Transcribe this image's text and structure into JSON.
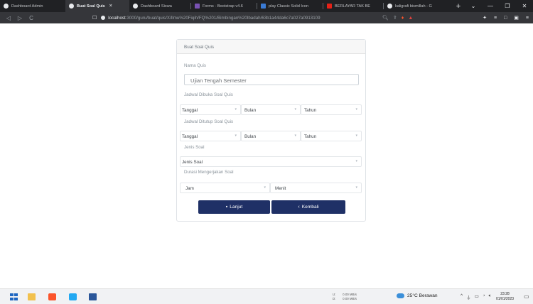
{
  "browser": {
    "tabs": [
      {
        "label": "Dashboard Admin",
        "active": false
      },
      {
        "label": "Buat Soal Quis",
        "active": true
      },
      {
        "label": "Dashboard Siswa",
        "active": false
      },
      {
        "label": "Forms · Bootstrap v4.6",
        "active": false
      },
      {
        "label": "play Classic Solid Icon",
        "active": false
      },
      {
        "label": "BERLAYAR TAK BE",
        "active": false
      },
      {
        "label": "kaligrafi bismillah - G",
        "active": false
      }
    ],
    "tab_close": "×",
    "new_tab": "+",
    "window_controls": {
      "minimize": "—",
      "restore": "❐",
      "close": "✕"
    },
    "nav": {
      "back": "◁",
      "forward": "▷",
      "reload": "C"
    },
    "url_host": "localhost",
    "url_path": ":3000/guru/buat/quis/X/Ilmu%20Fiqih/FQ%201/Bimbingan%20Ibadah/63b1a44da6c7a027a0913109"
  },
  "form": {
    "header": "Buat Soal Quis",
    "nama_label": "Nama Quis",
    "nama_value": "Ujian Tengah Semester",
    "open_label": "Jadwal Dibuka Soal Quis",
    "open_day": "Tanggal",
    "open_month": "Bulan",
    "open_year": "Tahun",
    "close_label": "Jadwal Ditutup Soal Quis",
    "close_day": "Tanggal",
    "close_month": "Bulan",
    "close_year": "Tahun",
    "jenis_label": "Jenis Soal",
    "jenis_value": "Jenis Soal",
    "durasi_label": "Durasi Mengerjakan Soal",
    "durasi_jam": "Jam",
    "durasi_menit": "Menit",
    "lanjut_label": "Lanjut",
    "kembali_label": "Kembali",
    "accent_color": "#1f3066"
  },
  "taskbar": {
    "net_upload": "0.00 MB/s",
    "net_download": "0.00 MB/s",
    "net_u": "U:",
    "net_d": "D:",
    "weather": "25°C  Berawan",
    "time": "23:28",
    "date": "01/01/2023"
  }
}
